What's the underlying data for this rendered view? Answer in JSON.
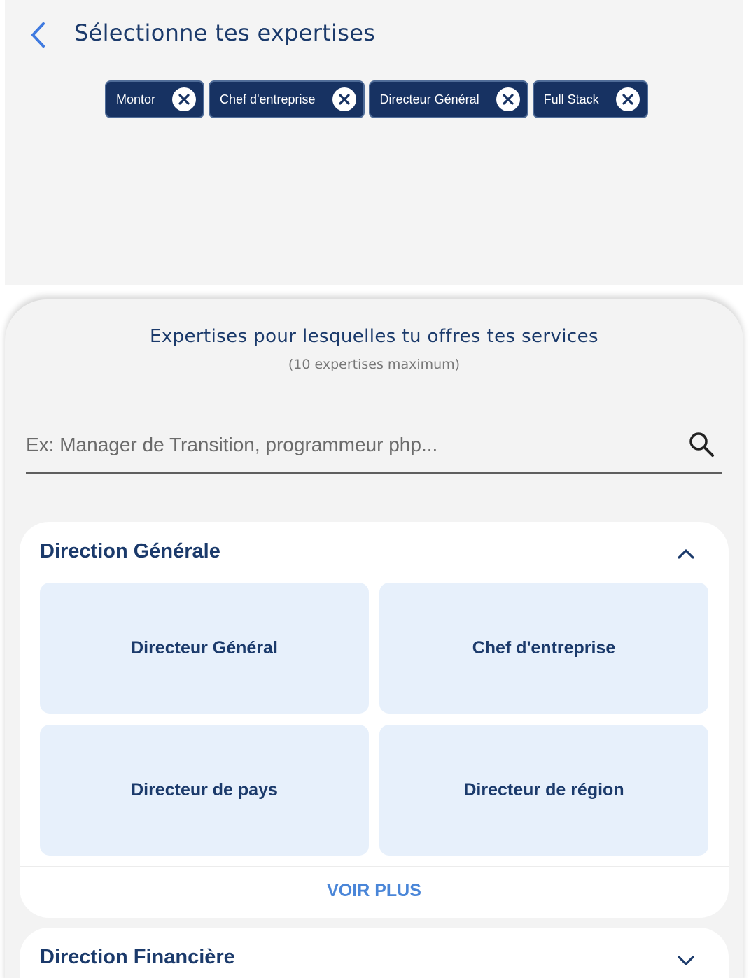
{
  "header": {
    "title": "Sélectionne tes expertises",
    "back_icon": "chevron-left-icon"
  },
  "selected_chips": [
    {
      "label": "Montor"
    },
    {
      "label": "Chef d'entreprise"
    },
    {
      "label": "Directeur Général"
    },
    {
      "label": "Full Stack"
    }
  ],
  "sheet": {
    "title": "Expertises pour lesquelles tu offres tes services",
    "subtitle": "(10 expertises maximum)",
    "search": {
      "placeholder": "Ex: Manager de Transition, programmeur php...",
      "value": ""
    }
  },
  "categories": [
    {
      "title": "Direction Générale",
      "expanded": true,
      "items": [
        "Directeur Général",
        "Chef d'entreprise",
        "Directeur de pays",
        "Directeur de région"
      ],
      "more_label": "VOIR PLUS"
    },
    {
      "title": "Direction Financière",
      "expanded": false
    }
  ],
  "colors": {
    "primary_dark": "#1b3a6b",
    "chip_bg": "#173262",
    "accent": "#4a86d8",
    "tile_bg": "#e7f0fb",
    "page_bg": "#f4f4f4"
  }
}
